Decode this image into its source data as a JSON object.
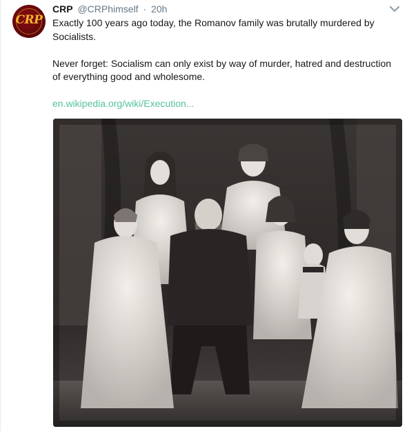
{
  "tweet": {
    "author_name": "CRP",
    "author_handle": "@CRPhimself",
    "separator": "·",
    "timestamp": "20h",
    "avatar_text": "CRP",
    "paragraph_1": "Exactly 100 years ago today, the Romanov family was brutally murdered by Socialists.",
    "paragraph_2": "Never forget: Socialism can only exist by way of murder, hatred and destruction of everything good and wholesome.",
    "link_text": "en.wikipedia.org/wiki/Execution..."
  },
  "icons": {
    "menu": "chevron-down-icon"
  },
  "colors": {
    "link": "#55c0a0",
    "secondary_text": "#657786",
    "avatar_bg": "#6b080d",
    "avatar_text": "#f1b42a"
  }
}
